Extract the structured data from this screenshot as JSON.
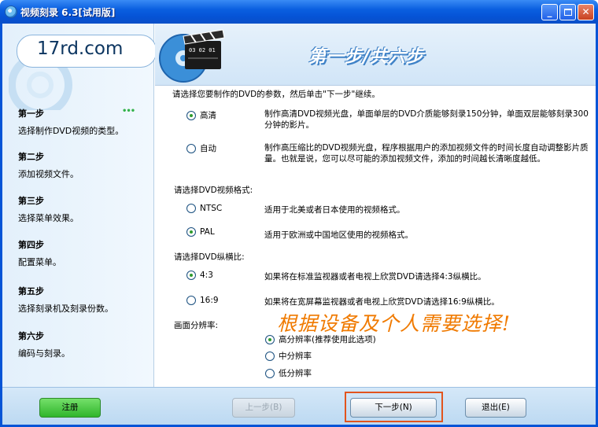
{
  "window": {
    "title": "视频刻录 6.3[试用版]",
    "buttons": {
      "minimize": "_",
      "close": "✕"
    }
  },
  "sidebar": {
    "logo": "17rd.com",
    "steps": [
      {
        "title": "第一步",
        "desc": "选择制作DVD视频的类型。"
      },
      {
        "title": "第二步",
        "desc": "添加视频文件。"
      },
      {
        "title": "第三步",
        "desc": "选择菜单效果。"
      },
      {
        "title": "第四步",
        "desc": "配置菜单。"
      },
      {
        "title": "第五步",
        "desc": "选择刻录机及刻录份数。"
      },
      {
        "title": "第六步",
        "desc": "编码与刻录。"
      }
    ],
    "current_step_marker": "•••"
  },
  "header": {
    "title": "第一步/共六步",
    "clapper_text": "03 02 01"
  },
  "main": {
    "intro": "请选择您要制作的DVD的参数，然后单击\"下一步\"继续。",
    "quality": {
      "options": [
        {
          "label": "高清",
          "selected": true,
          "desc": "制作高清DVD视频光盘，单面单层的DVD介质能够刻录150分钟，单面双层能够刻录300分钟的影片。"
        },
        {
          "label": "自动",
          "selected": false,
          "desc": "制作高压缩比的DVD视频光盘，程序根据用户的添加视频文件的时间长度自动调整影片质量。也就是说，您可以尽可能的添加视频文件，添加的时间越长清晰度越低。"
        }
      ]
    },
    "format": {
      "heading": "请选择DVD视频格式:",
      "options": [
        {
          "label": "NTSC",
          "selected": false,
          "desc": "适用于北美或者日本使用的视频格式。"
        },
        {
          "label": "PAL",
          "selected": true,
          "desc": "适用于欧洲或中国地区使用的视频格式。"
        }
      ]
    },
    "aspect": {
      "heading": "请选择DVD纵横比:",
      "options": [
        {
          "label": "4:3",
          "selected": true,
          "desc": "如果将在标准监视器或者电视上欣赏DVD请选择4:3纵横比。"
        },
        {
          "label": "16:9",
          "selected": false,
          "desc": "如果将在宽屏幕监视器或者电视上欣赏DVD请选择16:9纵横比。"
        }
      ]
    },
    "resolution": {
      "heading": "画面分辨率:",
      "options": [
        {
          "label": "高分辨率(推荐使用此选项)",
          "selected": true
        },
        {
          "label": "中分辨率",
          "selected": false
        },
        {
          "label": "低分辨率",
          "selected": false
        }
      ]
    },
    "annotation": "根据设备及个人需要选择!"
  },
  "footer": {
    "register": "注册",
    "prev": "上一步(B)",
    "next": "下一步(N)",
    "exit": "退出(E)"
  }
}
